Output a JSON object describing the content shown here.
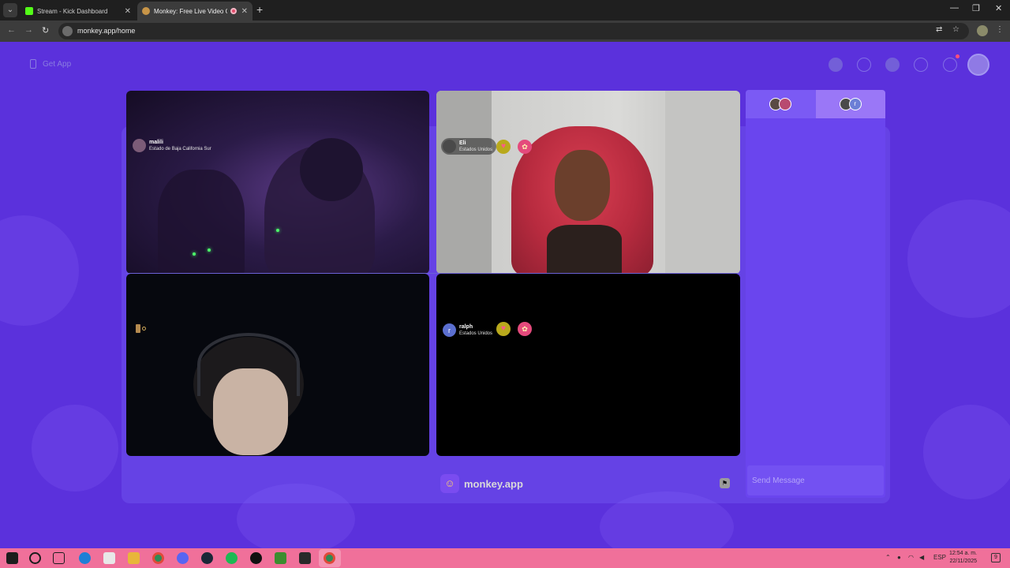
{
  "browser": {
    "tabs": [
      {
        "title": "Stream - Kick Dashboard",
        "favicon_color": "#53fc18",
        "active": false
      },
      {
        "title": "Monkey: Free Live Video Chat",
        "favicon_color": "#c89548",
        "active": true
      }
    ],
    "url": "monkey.app/home"
  },
  "header": {
    "get_app_label": "Get App"
  },
  "tiles": [
    {
      "name": "malili",
      "location": "Estado de Baja California Sur"
    },
    {
      "name": "Eli",
      "location": "Estados Unidos"
    },
    {
      "name": "ralph",
      "location": "Estados Unidos",
      "initial": "r"
    }
  ],
  "brand": {
    "name": "monkey.app"
  },
  "chat": {
    "tab2_initial": "r",
    "input_placeholder": "Send Message"
  },
  "taskbar": {
    "lang": "ESP",
    "time": "12:54 a. m.",
    "date": "22/11/2025",
    "notifications": "9"
  },
  "colors": {
    "page_bg": "#5b31dc",
    "chat_bg": "#6a45ee",
    "taskbar": "#f0709a",
    "accent": "#7b5af4"
  }
}
